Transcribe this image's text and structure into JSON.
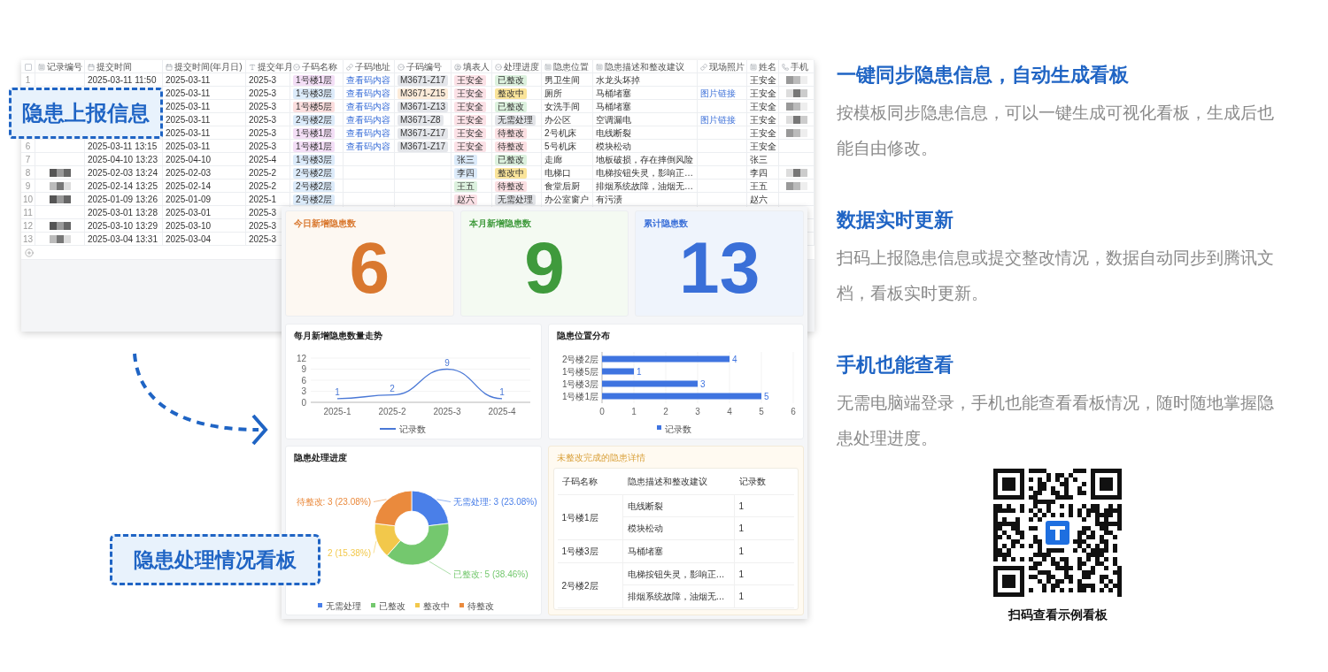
{
  "table": {
    "select_all": {
      "checked": false
    },
    "columns": [
      {
        "label": "记录编号",
        "kind": "text"
      },
      {
        "label": "提交时间",
        "kind": "date"
      },
      {
        "label": "提交时间(年月日)",
        "kind": "date"
      },
      {
        "label": "提交年月",
        "kind": "formula"
      },
      {
        "label": "子码名称",
        "kind": "option"
      },
      {
        "label": "子码地址",
        "kind": "link"
      },
      {
        "label": "子码编号",
        "kind": "option"
      },
      {
        "label": "填表人",
        "kind": "person"
      },
      {
        "label": "处理进度",
        "kind": "option"
      },
      {
        "label": "隐患位置",
        "kind": "text"
      },
      {
        "label": "隐患描述和整改建议",
        "kind": "text"
      },
      {
        "label": "现场照片",
        "kind": "link"
      },
      {
        "label": "姓名",
        "kind": "text"
      },
      {
        "label": "手机",
        "kind": "phone"
      }
    ],
    "rows": [
      {
        "no": "1",
        "id_redacted": false,
        "submit_time": "2025-03-11 11:50",
        "submit_date": "2025-03-11",
        "year_month": "2025-3",
        "code_name": {
          "text": "1号楼1层",
          "color": "#f3def6"
        },
        "code_url": "查看码内容",
        "code_no": {
          "text": "M3671-Z17",
          "color": "#e4e6ea"
        },
        "reporter": {
          "text": "王安全",
          "color": "#fbe1e6"
        },
        "status": {
          "text": "已整改",
          "color": "#dcf1de"
        },
        "location": "男卫生间",
        "description": "水龙头坏掉",
        "name": "王安全",
        "phone_redacted": true
      },
      {
        "id_redacted": false,
        "submit_date": "2025-03-11",
        "year_month": "2025-3",
        "code_name": {
          "text": "1号楼3层",
          "color": "#dcebfa"
        },
        "code_url": "查看码内容",
        "code_no": {
          "text": "M3671-Z15",
          "color": "#fcebd9"
        },
        "reporter": {
          "text": "王安全",
          "color": "#fbe1e6"
        },
        "status": {
          "text": "整改中",
          "color": "#fae49a"
        },
        "location": "厕所",
        "description": "马桶堵塞",
        "photo": "图片链接",
        "name": "王安全",
        "phone_redacted": true
      },
      {
        "id_redacted": false,
        "submit_date": "2025-03-11",
        "year_month": "2025-3",
        "code_name": {
          "text": "1号楼5层",
          "color": "#fbdede"
        },
        "code_url": "查看码内容",
        "code_no": {
          "text": "M3671-Z13",
          "color": "#e4e6ea"
        },
        "reporter": {
          "text": "王安全",
          "color": "#fbe1e6"
        },
        "status": {
          "text": "已整改",
          "color": "#dcf1de"
        },
        "location": "女洗手间",
        "description": "马桶堵塞",
        "name": "王安全",
        "phone_redacted": true
      },
      {
        "id_redacted": false,
        "submit_date": "2025-03-11",
        "year_month": "2025-3",
        "code_name": {
          "text": "2号楼2层",
          "color": "#dcebfa"
        },
        "code_url": "查看码内容",
        "code_no": {
          "text": "M3671-Z8",
          "color": "#e4e6ea"
        },
        "reporter": {
          "text": "王安全",
          "color": "#fbe1e6"
        },
        "status": {
          "text": "无需处理",
          "color": "#e2e4e8"
        },
        "location": "办公区",
        "description": "空调漏电",
        "photo": "图片链接",
        "name": "王安全",
        "phone_redacted": true
      },
      {
        "id_redacted": false,
        "submit_date": "2025-03-11",
        "year_month": "2025-3",
        "code_name": {
          "text": "1号楼1层",
          "color": "#f3def6"
        },
        "code_url": "查看码内容",
        "code_no": {
          "text": "M3671-Z17",
          "color": "#e4e6ea"
        },
        "reporter": {
          "text": "王安全",
          "color": "#fbe1e6"
        },
        "status": {
          "text": "待整改",
          "color": "#fbdfe2"
        },
        "location": "2号机床",
        "description": "电线断裂",
        "name": "王安全",
        "phone_redacted": true
      },
      {
        "no": "6",
        "id_redacted": false,
        "submit_time": "2025-03-11 13:15",
        "submit_date": "2025-03-11",
        "year_month": "2025-3",
        "code_name": {
          "text": "1号楼1层",
          "color": "#f3def6"
        },
        "code_url": "查看码内容",
        "code_no": {
          "text": "M3671-Z17",
          "color": "#e4e6ea"
        },
        "reporter": {
          "text": "王安全",
          "color": "#fbe1e6"
        },
        "status": {
          "text": "待整改",
          "color": "#fbdfe2"
        },
        "location": "5号机床",
        "description": "模块松动",
        "name": "王安全",
        "phone_redacted": false
      },
      {
        "no": "7",
        "id_redacted": false,
        "submit_time": "2025-04-10 13:23",
        "submit_date": "2025-04-10",
        "year_month": "2025-4",
        "code_name": {
          "text": "1号楼3层",
          "color": "#dcebfa"
        },
        "reporter": {
          "text": "张三",
          "color": "#dcebfa"
        },
        "status": {
          "text": "已整改",
          "color": "#dcf1de"
        },
        "location": "走廊",
        "description": "地板破损，存在摔倒风险",
        "name": "张三",
        "phone_redacted": false
      },
      {
        "no": "8",
        "id_redacted": true,
        "submit_time": "2025-02-03 13:24",
        "submit_date": "2025-02-03",
        "year_month": "2025-2",
        "code_name": {
          "text": "2号楼2层",
          "color": "#dcebfa"
        },
        "reporter": {
          "text": "李四",
          "color": "#dcebfa"
        },
        "status": {
          "text": "整改中",
          "color": "#fae49a"
        },
        "location": "电梯口",
        "description": "电梯按钮失灵，影响正…",
        "name": "李四",
        "phone_redacted": true
      },
      {
        "no": "9",
        "id_redacted": true,
        "submit_time": "2025-02-14 13:25",
        "submit_date": "2025-02-14",
        "year_month": "2025-2",
        "code_name": {
          "text": "2号楼2层",
          "color": "#dcebfa"
        },
        "reporter": {
          "text": "王五",
          "color": "#dcf1de"
        },
        "status": {
          "text": "待整改",
          "color": "#fbdfe2"
        },
        "location": "食堂后厨",
        "description": "排烟系统故障，油烟无…",
        "name": "王五",
        "phone_redacted": true
      },
      {
        "no": "10",
        "id_redacted": true,
        "submit_time": "2025-01-09 13:26",
        "submit_date": "2025-01-09",
        "year_month": "2025-1",
        "code_name": {
          "text": "2号楼2层",
          "color": "#dcebfa"
        },
        "reporter": {
          "text": "赵六",
          "color": "#fbe1e6"
        },
        "status": {
          "text": "无需处理",
          "color": "#e2e4e8"
        },
        "location": "办公室窗户",
        "description": "有污渍",
        "name": "赵六",
        "phone_redacted": false
      },
      {
        "no": "11",
        "id_redacted": false,
        "submit_time": "2025-03-01 13:28",
        "submit_date": "2025-03-01",
        "year_month": "2025-3"
      },
      {
        "no": "12",
        "id_redacted": true,
        "submit_time": "2025-03-10 13:29",
        "submit_date": "2025-03-10",
        "year_month": "2025-3"
      },
      {
        "no": "13",
        "id_redacted": true,
        "submit_time": "2025-03-04 13:31",
        "submit_date": "2025-03-04",
        "year_month": "2025-3"
      }
    ]
  },
  "callouts": [
    {
      "text": "隐患上报信息"
    },
    {
      "text": "隐患处理情况看板"
    }
  ],
  "dashboard": {
    "kpis": [
      {
        "label": "今日新增隐患数",
        "value": "6",
        "color": "#d9782f"
      },
      {
        "label": "本月新增隐患数",
        "value": "9",
        "color": "#3f9a3c"
      },
      {
        "label": "累计隐患数",
        "value": "13",
        "color": "#3a6fd8"
      }
    ],
    "trend_chart": {
      "chart_data": {
        "type": "line",
        "title": "每月新增隐患数量走势",
        "categories": [
          "2025-1",
          "2025-2",
          "2025-3",
          "2025-4"
        ],
        "series": [
          {
            "name": "记录数",
            "color": "#4a78d6",
            "values": [
              1,
              2,
              9,
              1
            ]
          }
        ],
        "ylim": [
          0,
          12
        ],
        "yticks": [
          0,
          3,
          6,
          9,
          12
        ],
        "grid": true,
        "legend": "bottom",
        "data_labels": true
      }
    },
    "location_chart": {
      "chart_data": {
        "type": "bar",
        "orientation": "horizontal",
        "title": "隐患位置分布",
        "categories": [
          "2号楼2层",
          "1号楼5层",
          "1号楼3层",
          "1号楼1层"
        ],
        "series": [
          {
            "name": "记录数",
            "color": "#3f74e0",
            "values": [
              4,
              1,
              3,
              5
            ]
          }
        ],
        "xlim": [
          0,
          6
        ],
        "xticks": [
          0,
          1,
          2,
          3,
          4,
          5,
          6
        ],
        "grid": true,
        "legend": "bottom",
        "data_labels": true
      }
    },
    "progress_chart": {
      "chart_data": {
        "type": "donut",
        "title": "隐患处理进度",
        "categories": [
          "无需处理",
          "已整改",
          "整改中",
          "待整改"
        ],
        "colors": [
          "#4a7fe8",
          "#74c86e",
          "#f2c84b",
          "#ea8a3d"
        ],
        "series": [
          {
            "values": [
              23.08,
              38.46,
              15.38,
              23.08
            ]
          }
        ],
        "legend": "bottom",
        "value_labels": [
          "无需处理: 3 (23.08%)",
          "已整改: 5 (38.46%)",
          "2 (15.38%)",
          "待整改: 3 (23.08%)"
        ]
      }
    },
    "details": {
      "title": "未整改完成的隐患详情",
      "columns": [
        "子码名称",
        "隐患描述和整改建议",
        "记录数"
      ],
      "groups": [
        {
          "name": "1号楼1层",
          "items": [
            {
              "description": "电线断裂",
              "count": "1"
            },
            {
              "description": "模块松动",
              "count": "1"
            }
          ]
        },
        {
          "name": "1号楼3层",
          "items": [
            {
              "description": "马桶堵塞",
              "count": "1"
            }
          ]
        },
        {
          "name": "2号楼2层",
          "items": [
            {
              "description": "电梯按钮失灵，影响正…",
              "count": "1"
            },
            {
              "description": "排烟系统故障，油烟无…",
              "count": "1"
            }
          ]
        }
      ]
    }
  },
  "features": [
    {
      "title": "一键同步隐患信息，自动生成看板",
      "text": "按模板同步隐患信息，可以一键生成可视化看板，生成后也能自由修改。"
    },
    {
      "title": "数据实时更新",
      "text": "扫码上报隐患信息或提交整改情况，数据自动同步到腾讯文档，看板实时更新。"
    },
    {
      "title": "手机也能查看",
      "text": "无需电脑端登录，手机也能查看看板情况，随时随地掌握隐患处理进度。"
    }
  ],
  "qr": {
    "caption": "扫码查看示例看板"
  }
}
